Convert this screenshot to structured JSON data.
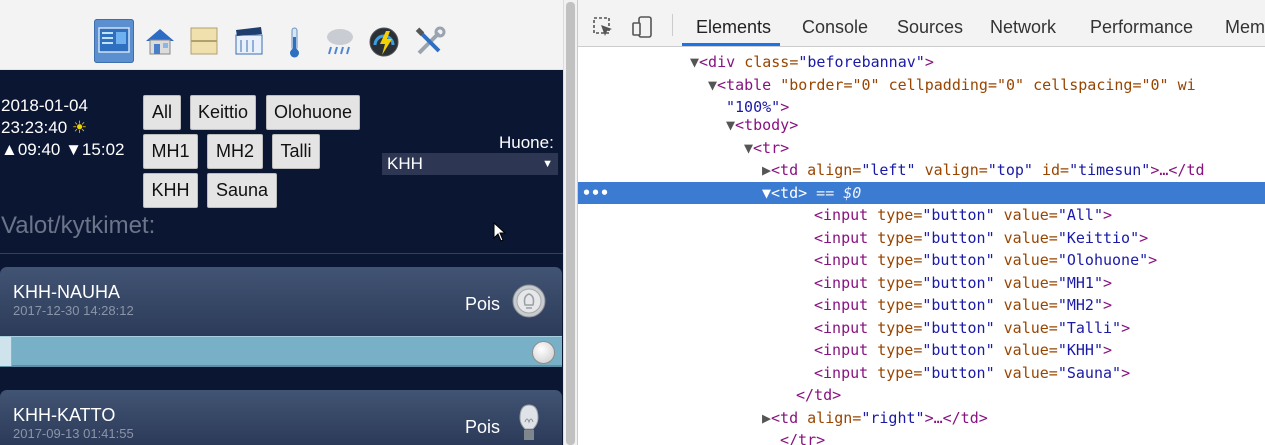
{
  "app": {
    "nav_icons": [
      {
        "name": "dashboard-icon",
        "active": true
      },
      {
        "name": "home-icon",
        "active": false
      },
      {
        "name": "blinds-icon",
        "active": false
      },
      {
        "name": "scene-clapper-icon",
        "active": false
      },
      {
        "name": "thermometer-icon",
        "active": false
      },
      {
        "name": "rain-cloud-icon",
        "active": false
      },
      {
        "name": "energy-gauge-icon",
        "active": false
      },
      {
        "name": "tools-icon",
        "active": false
      }
    ],
    "timesun": {
      "date": "2018-01-04",
      "time": "23:23:40",
      "sun_symbol": "☀",
      "sunrise": "▲09:40",
      "sunset": "▼15:02"
    },
    "room_buttons": [
      "All",
      "Keittio",
      "Olohuone",
      "MH1",
      "MH2",
      "Talli",
      "KHH",
      "Sauna"
    ],
    "room_label": "Huone:",
    "room_select": {
      "value": "KHH",
      "arrow": "▼"
    },
    "section_title": "Valot/kytkimet:",
    "devices": [
      {
        "name": "KHH-NAUHA",
        "timestamp": "2017-12-30 14:28:12",
        "state": "Pois",
        "icon": "bulb-off-icon",
        "dimmer_level": 1.0
      },
      {
        "name": "KHH-KATTO",
        "timestamp": "2017-09-13 01:41:55",
        "state": "Pois",
        "icon": "bulb-icon"
      }
    ]
  },
  "devtools": {
    "tools": [
      {
        "name": "inspect-element-icon"
      },
      {
        "name": "device-toolbar-icon"
      }
    ],
    "tabs": [
      "Elements",
      "Console",
      "Sources",
      "Network",
      "Performance",
      "Mem"
    ],
    "active_tab": "Elements",
    "selection_dots": "•••",
    "tree": [
      {
        "tri": "▼",
        "pre": "<div ",
        "attrs": [
          [
            "class",
            "\"beforebannav\""
          ]
        ],
        "post": ">"
      },
      {
        "tri": "▼",
        "pre": "<table ",
        "attrs": [
          [
            "\"border=\"0\" cellpadding=\"0\" cellspacing=\"0\" wi",
            ""
          ]
        ],
        "post": ""
      },
      {
        "tri": "",
        "pre": "",
        "attrs": [
          [
            "",
            "\"100%\""
          ]
        ],
        "post": ">"
      },
      {
        "tri": "▼",
        "pre": "<tbody>",
        "attrs": [],
        "post": ""
      },
      {
        "tri": "▼",
        "pre": "<tr>",
        "attrs": [],
        "post": ""
      },
      {
        "tri": "▶",
        "pre": "<td ",
        "attrs": [
          [
            "align",
            "\"left\""
          ],
          [
            "valign",
            "\"top\""
          ],
          [
            "id",
            "\"timesun\""
          ]
        ],
        "post": ">…</td"
      },
      {
        "tri": "▼",
        "pre": "<td>",
        "attrs": [],
        "post": " == $0",
        "selected": true
      },
      {
        "tri": "",
        "pre": "<input ",
        "attrs": [
          [
            "type",
            "\"button\""
          ],
          [
            "value",
            "\"All\""
          ]
        ],
        "post": ">"
      },
      {
        "tri": "",
        "pre": "<input ",
        "attrs": [
          [
            "type",
            "\"button\""
          ],
          [
            "value",
            "\"Keittio\""
          ]
        ],
        "post": ">"
      },
      {
        "tri": "",
        "pre": "<input ",
        "attrs": [
          [
            "type",
            "\"button\""
          ],
          [
            "value",
            "\"Olohuone\""
          ]
        ],
        "post": ">"
      },
      {
        "tri": "",
        "pre": "<input ",
        "attrs": [
          [
            "type",
            "\"button\""
          ],
          [
            "value",
            "\"MH1\""
          ]
        ],
        "post": ">"
      },
      {
        "tri": "",
        "pre": "<input ",
        "attrs": [
          [
            "type",
            "\"button\""
          ],
          [
            "value",
            "\"MH2\""
          ]
        ],
        "post": ">"
      },
      {
        "tri": "",
        "pre": "<input ",
        "attrs": [
          [
            "type",
            "\"button\""
          ],
          [
            "value",
            "\"Talli\""
          ]
        ],
        "post": ">"
      },
      {
        "tri": "",
        "pre": "<input ",
        "attrs": [
          [
            "type",
            "\"button\""
          ],
          [
            "value",
            "\"KHH\""
          ]
        ],
        "post": ">"
      },
      {
        "tri": "",
        "pre": "<input ",
        "attrs": [
          [
            "type",
            "\"button\""
          ],
          [
            "value",
            "\"Sauna\""
          ]
        ],
        "post": ">"
      },
      {
        "tri": "",
        "pre": "</td>",
        "attrs": [],
        "post": ""
      },
      {
        "tri": "▶",
        "pre": "<td ",
        "attrs": [
          [
            "align",
            "\"right\""
          ]
        ],
        "post": ">…</td>"
      },
      {
        "tri": "",
        "pre": "</tr>",
        "attrs": [],
        "post": ""
      }
    ]
  }
}
